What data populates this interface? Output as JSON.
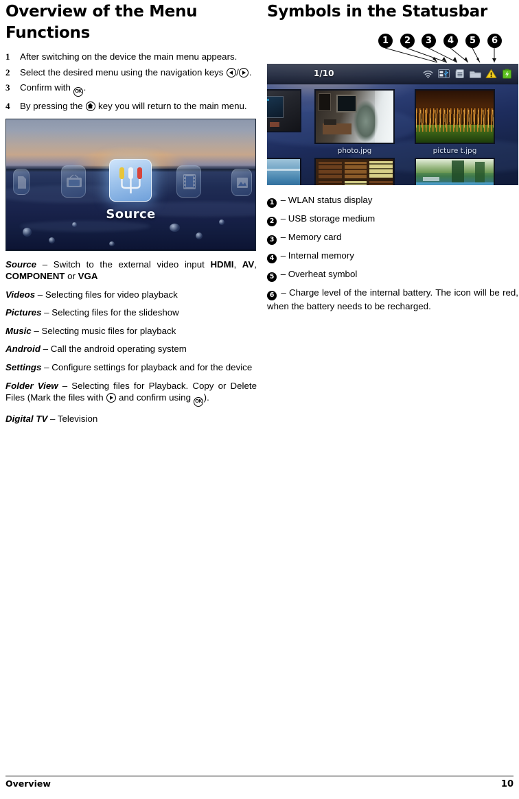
{
  "left": {
    "title": "Overview of the Menu Functions",
    "steps": [
      {
        "num": "1",
        "parts": [
          {
            "t": "After switching on the device the main menu appears."
          }
        ]
      },
      {
        "num": "2",
        "parts": [
          {
            "t": "Select the desired menu using the navigation keys "
          },
          {
            "icon": "arrow-left-key"
          },
          {
            "t": "/"
          },
          {
            "icon": "arrow-right-key"
          },
          {
            "t": "."
          }
        ]
      },
      {
        "num": "3",
        "parts": [
          {
            "t": "Confirm with "
          },
          {
            "icon": "ok-key"
          },
          {
            "t": "."
          }
        ]
      },
      {
        "num": "4",
        "parts": [
          {
            "t": "By pressing the "
          },
          {
            "icon": "home-key"
          },
          {
            "t": " key you will return to the main menu."
          }
        ]
      }
    ],
    "menu_screenshot": {
      "selected_label": "Source",
      "tiles": [
        {
          "name": "document-tile"
        },
        {
          "name": "tv-tile"
        },
        {
          "name": "source-tile"
        },
        {
          "name": "film-tile"
        },
        {
          "name": "picture-tile"
        }
      ]
    },
    "definitions": [
      {
        "term": "Source",
        "parts": [
          {
            "t": " – Switch to the external video input "
          },
          {
            "t": "HDMI",
            "b": true
          },
          {
            "t": ", "
          },
          {
            "t": "AV",
            "b": true
          },
          {
            "t": ", "
          },
          {
            "t": "COMPONENT",
            "b": true
          },
          {
            "t": " or "
          },
          {
            "t": "VGA",
            "b": true
          }
        ]
      },
      {
        "term": "Videos",
        "parts": [
          {
            "t": " – Selecting files for video playback"
          }
        ]
      },
      {
        "term": "Pictures",
        "parts": [
          {
            "t": " – Selecting files for the slideshow"
          }
        ]
      },
      {
        "term": "Music",
        "parts": [
          {
            "t": " – Selecting music files for playback"
          }
        ]
      },
      {
        "term": "Android",
        "parts": [
          {
            "t": " – Call the android operating system"
          }
        ]
      },
      {
        "term": "Settings",
        "parts": [
          {
            "t": " – Configure settings for playback and for the device"
          }
        ]
      },
      {
        "term": "Folder View",
        "parts": [
          {
            "t": " – Selecting files for Playback. Copy or Delete Files (Mark the files with "
          },
          {
            "icon": "arrow-right-key"
          },
          {
            "t": " and confirm using "
          },
          {
            "icon": "ok-key"
          },
          {
            "t": ")."
          }
        ]
      },
      {
        "term": "Digital TV",
        "parts": [
          {
            "t": " – Television"
          }
        ]
      }
    ]
  },
  "right": {
    "title": "Symbols in the Statusbar",
    "callout_badges": [
      "1",
      "2",
      "3",
      "4",
      "5",
      "6"
    ],
    "status_screenshot": {
      "counter": "1/10",
      "tray_icons": [
        "wlan-icon",
        "usb-icon",
        "memory-card-icon",
        "folder-icon",
        "overheat-warning-icon",
        "battery-icon"
      ],
      "thumbnails": [
        {
          "name": "thumbnail-room",
          "caption": ""
        },
        {
          "name": "thumbnail-tree",
          "caption": "photo.jpg"
        },
        {
          "name": "thumbnail-moss",
          "caption": "picture t.jpg"
        },
        {
          "name": "thumbnail-water",
          "caption": ""
        },
        {
          "name": "thumbnail-chocolates",
          "caption": ""
        },
        {
          "name": "thumbnail-pool",
          "caption": ""
        }
      ]
    },
    "legend": [
      {
        "num": "1",
        "text": " – WLAN status display"
      },
      {
        "num": "2",
        "text": " – USB storage medium"
      },
      {
        "num": "3",
        "text": " – Memory card"
      },
      {
        "num": "4",
        "text": " – Internal memory"
      },
      {
        "num": "5",
        "text": " – Overheat symbol"
      },
      {
        "num": "6",
        "text": " – Charge level of the internal battery. The icon will be red, when the battery needs to be recharged.",
        "wrap": true
      }
    ]
  },
  "footer": {
    "left": "Overview",
    "page": "10"
  },
  "colors": {
    "badge_bg": "#000000",
    "badge_fg": "#ffffff",
    "warning_yellow": "#f5d020",
    "battery_green": "#5cc020",
    "usb_blue": "#4aa8e8"
  }
}
